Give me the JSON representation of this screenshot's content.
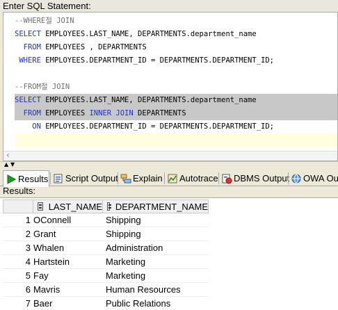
{
  "header": {
    "label": "Enter SQL Statement:"
  },
  "editor": {
    "lines": [
      [
        {
          "t": "--WHERE절 JOIN",
          "c": "cm"
        }
      ],
      [
        {
          "t": "SELECT",
          "c": "kw"
        },
        {
          "t": " EMPLOYEES.LAST_NAME, DEPARTMENTS.department_name",
          "c": ""
        }
      ],
      [
        {
          "t": "  FROM",
          "c": "kw"
        },
        {
          "t": " EMPLOYEES , DEPARTMENTS",
          "c": ""
        }
      ],
      [
        {
          "t": " WHERE",
          "c": "kw"
        },
        {
          "t": " EMPLOYEES.DEPARTMENT_ID = DEPARTMENTS.DEPARTMENT_ID;",
          "c": ""
        }
      ],
      [],
      [
        {
          "t": "--FROM절 JOIN",
          "c": "cm"
        }
      ],
      [
        {
          "t": "SELECT",
          "c": "kw"
        },
        {
          "t": " EMPLOYEES.LAST_NAME, DEPARTMENTS.department_name",
          "c": ""
        }
      ],
      [
        {
          "t": "  FROM",
          "c": "kw"
        },
        {
          "t": " EMPLOYEES ",
          "c": ""
        },
        {
          "t": "INNER JOIN",
          "c": "kw"
        },
        {
          "t": " DEPARTMENTS",
          "c": ""
        }
      ],
      [
        {
          "t": "    ON",
          "c": "kw"
        },
        {
          "t": " EMPLOYEES.DEPARTMENT_ID = DEPARTMENTS.DEPARTMENT_ID;",
          "c": ""
        }
      ]
    ]
  },
  "tabs": [
    {
      "label": "Results",
      "icon": "green-play-icon"
    },
    {
      "label": "Script Output",
      "icon": "script-output-icon"
    },
    {
      "label": "Explain",
      "icon": "explain-plan-icon"
    },
    {
      "label": "Autotrace",
      "icon": "autotrace-icon"
    },
    {
      "label": "DBMS Output",
      "icon": "dbms-output-icon"
    },
    {
      "label": "OWA Out",
      "icon": "owa-output-icon"
    }
  ],
  "results": {
    "label": "Results:",
    "columns": [
      "LAST_NAME",
      "DEPARTMENT_NAME"
    ],
    "rows": [
      [
        "1",
        "OConnell",
        "Shipping"
      ],
      [
        "2",
        "Grant",
        "Shipping"
      ],
      [
        "3",
        "Whalen",
        "Administration"
      ],
      [
        "4",
        "Hartstein",
        "Marketing"
      ],
      [
        "5",
        "Fay",
        "Marketing"
      ],
      [
        "6",
        "Mavris",
        "Human Resources"
      ],
      [
        "7",
        "Baer",
        "Public Relations"
      ]
    ]
  }
}
